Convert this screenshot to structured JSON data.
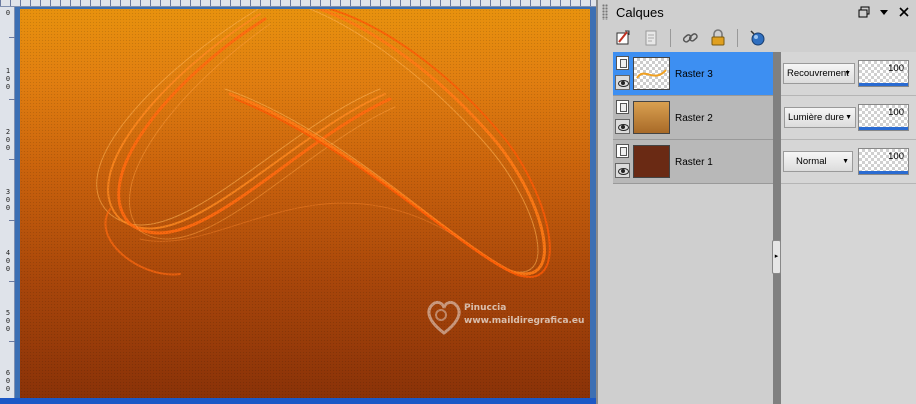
{
  "panel": {
    "title": "Calques",
    "controls": [
      "restore-icon",
      "dropdown-icon",
      "close-icon"
    ],
    "toolbar": [
      "new-layer-icon",
      "layer-properties-icon",
      "link-icon",
      "lock-icon",
      "mask-icon"
    ]
  },
  "layers": [
    {
      "name": "Raster 3",
      "selected": true,
      "thumb": "transparent",
      "blend_mode": "Recouvrement",
      "opacity": "100"
    },
    {
      "name": "Raster 2",
      "selected": false,
      "thumb": "#c98a3a",
      "blend_mode": "Lumière dure",
      "opacity": "100"
    },
    {
      "name": "Raster 1",
      "selected": false,
      "thumb": "#6a2a14",
      "blend_mode": "Normal",
      "opacity": "100"
    }
  ],
  "ruler": {
    "labels": [
      "0",
      "1\n0\n0",
      "2\n0\n0",
      "3\n0\n0",
      "4\n0\n0",
      "5\n0\n0",
      "6\n0\n0"
    ]
  },
  "watermark": {
    "name": "Pinuccia",
    "url": "www.maildiregrafica.eu"
  },
  "colors": {
    "accent": "#3d8ff2",
    "canvas_top": "#e8920e",
    "canvas_bottom": "#8a3208"
  }
}
